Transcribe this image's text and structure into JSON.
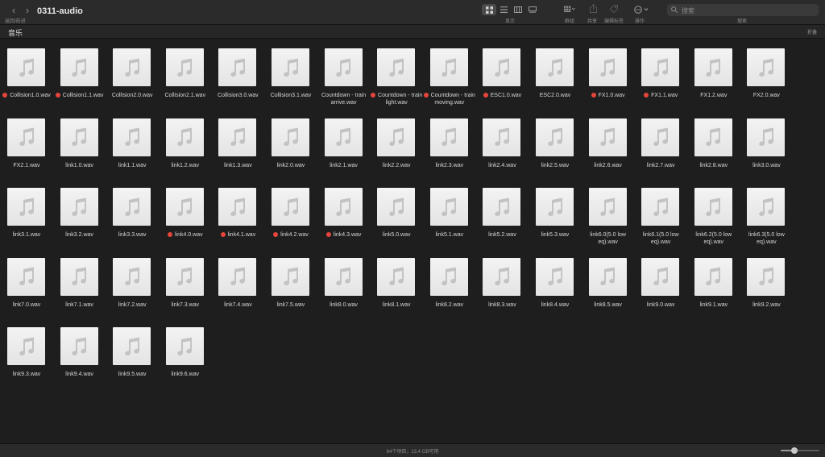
{
  "toolbar": {
    "back_forward_label": "返回/前进",
    "title": "0311-audio",
    "view_label": "显示",
    "group_label": "群组",
    "share_label": "共享",
    "tags_label": "编辑标签",
    "action_label": "操作",
    "search_label": "搜索",
    "search_placeholder": "搜索"
  },
  "pathbar": {
    "folder": "音乐",
    "collapse": "折叠"
  },
  "colors": {
    "tag_red": "#e5453b",
    "background": "#1e1e1e"
  },
  "files": [
    {
      "name": "Collision1.0.wav",
      "tag": "red"
    },
    {
      "name": "Collision1.1.wav",
      "tag": "red"
    },
    {
      "name": "Collision2.0.wav",
      "tag": ""
    },
    {
      "name": "Collision2.1.wav",
      "tag": ""
    },
    {
      "name": "Collision3.0.wav",
      "tag": ""
    },
    {
      "name": "Collision3.1.wav",
      "tag": ""
    },
    {
      "name": "Countdown - train arrive.wav",
      "tag": ""
    },
    {
      "name": "Countdown - train light.wav",
      "tag": "red"
    },
    {
      "name": "Countdown - train moving.wav",
      "tag": "red"
    },
    {
      "name": "ESC1.0.wav",
      "tag": "red"
    },
    {
      "name": "ESC2.0.wav",
      "tag": ""
    },
    {
      "name": "FX1.0.wav",
      "tag": "red"
    },
    {
      "name": "FX1.1.wav",
      "tag": "red"
    },
    {
      "name": "FX1.2.wav",
      "tag": ""
    },
    {
      "name": "FX2.0.wav",
      "tag": ""
    },
    {
      "name": "FX2.1.wav",
      "tag": ""
    },
    {
      "name": "link1.0.wav",
      "tag": ""
    },
    {
      "name": "link1.1.wav",
      "tag": ""
    },
    {
      "name": "link1.2.wav",
      "tag": ""
    },
    {
      "name": "link1.3.wav",
      "tag": ""
    },
    {
      "name": "link2.0.wav",
      "tag": ""
    },
    {
      "name": "link2.1.wav",
      "tag": ""
    },
    {
      "name": "link2.2.wav",
      "tag": ""
    },
    {
      "name": "link2.3.wav",
      "tag": ""
    },
    {
      "name": "link2.4.wav",
      "tag": ""
    },
    {
      "name": "link2.5.wav",
      "tag": ""
    },
    {
      "name": "link2.6.wav",
      "tag": ""
    },
    {
      "name": "link2.7.wav",
      "tag": ""
    },
    {
      "name": "link2.8.wav",
      "tag": ""
    },
    {
      "name": "link3.0.wav",
      "tag": ""
    },
    {
      "name": "link3.1.wav",
      "tag": ""
    },
    {
      "name": "link3.2.wav",
      "tag": ""
    },
    {
      "name": "link3.3.wav",
      "tag": ""
    },
    {
      "name": "link4.0.wav",
      "tag": "red"
    },
    {
      "name": "link4.1.wav",
      "tag": "red"
    },
    {
      "name": "link4.2.wav",
      "tag": "red"
    },
    {
      "name": "link4.3.wav",
      "tag": "red"
    },
    {
      "name": "link5.0.wav",
      "tag": ""
    },
    {
      "name": "link5.1.wav",
      "tag": ""
    },
    {
      "name": "link5.2.wav",
      "tag": ""
    },
    {
      "name": "link5.3.wav",
      "tag": ""
    },
    {
      "name": "link6.0(5.0 low eq).wav",
      "tag": ""
    },
    {
      "name": "link6.1(5.0 low eq).wav",
      "tag": ""
    },
    {
      "name": "link6.2(5.0 low eq).wav",
      "tag": ""
    },
    {
      "name": "link6.3(5.0 low eq).wav",
      "tag": ""
    },
    {
      "name": "link7.0.wav",
      "tag": ""
    },
    {
      "name": "link7.1.wav",
      "tag": ""
    },
    {
      "name": "link7.2.wav",
      "tag": ""
    },
    {
      "name": "link7.3.wav",
      "tag": ""
    },
    {
      "name": "link7.4.wav",
      "tag": ""
    },
    {
      "name": "link7.5.wav",
      "tag": ""
    },
    {
      "name": "link8.0.wav",
      "tag": ""
    },
    {
      "name": "link8.1.wav",
      "tag": ""
    },
    {
      "name": "link8.2.wav",
      "tag": ""
    },
    {
      "name": "link8.3.wav",
      "tag": ""
    },
    {
      "name": "link8.4.wav",
      "tag": ""
    },
    {
      "name": "link8.5.wav",
      "tag": ""
    },
    {
      "name": "link9.0.wav",
      "tag": ""
    },
    {
      "name": "link9.1.wav",
      "tag": ""
    },
    {
      "name": "link9.2.wav",
      "tag": ""
    },
    {
      "name": "link9.3.wav",
      "tag": ""
    },
    {
      "name": "link9.4.wav",
      "tag": ""
    },
    {
      "name": "link9.5.wav",
      "tag": ""
    },
    {
      "name": "link9.6.wav",
      "tag": ""
    }
  ],
  "status": {
    "text": "64个项目，13.4 GB可用",
    "zoom_level": 0.35
  }
}
